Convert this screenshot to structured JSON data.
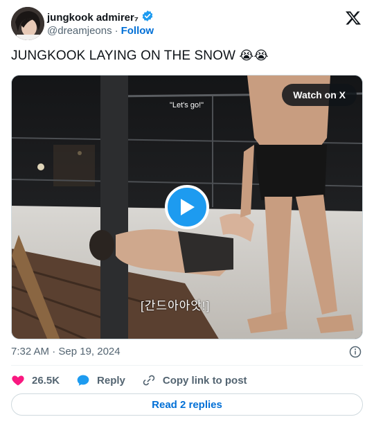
{
  "author": {
    "display_name": "jungkook admirer₇",
    "handle": "@dreamjeons",
    "separator": "·",
    "follow_label": "Follow",
    "verified_color": "#1d9bf0"
  },
  "tweet": {
    "text": "JUNGKOOK LAYING ON THE SNOW",
    "emojis": "😭😭"
  },
  "media": {
    "watch_label": "Watch on X",
    "caption_top": "\"Let's go!\"",
    "caption_bottom": "[간드아아앗!]",
    "play_color": "#1d9bf0"
  },
  "meta": {
    "timestamp": "7:32 AM · Sep 19, 2024"
  },
  "actions": {
    "like_count": "26.5K",
    "reply_label": "Reply",
    "copy_label": "Copy link to post",
    "like_color": "#f91880",
    "reply_color": "#1d9bf0"
  },
  "footer": {
    "read_replies_label": "Read 2 replies"
  },
  "icons": {
    "verified": "verified-badge-icon",
    "x_logo": "x-logo-icon",
    "play": "play-icon",
    "info": "info-icon",
    "heart": "heart-icon",
    "reply": "reply-bubble-icon",
    "link": "link-icon"
  }
}
